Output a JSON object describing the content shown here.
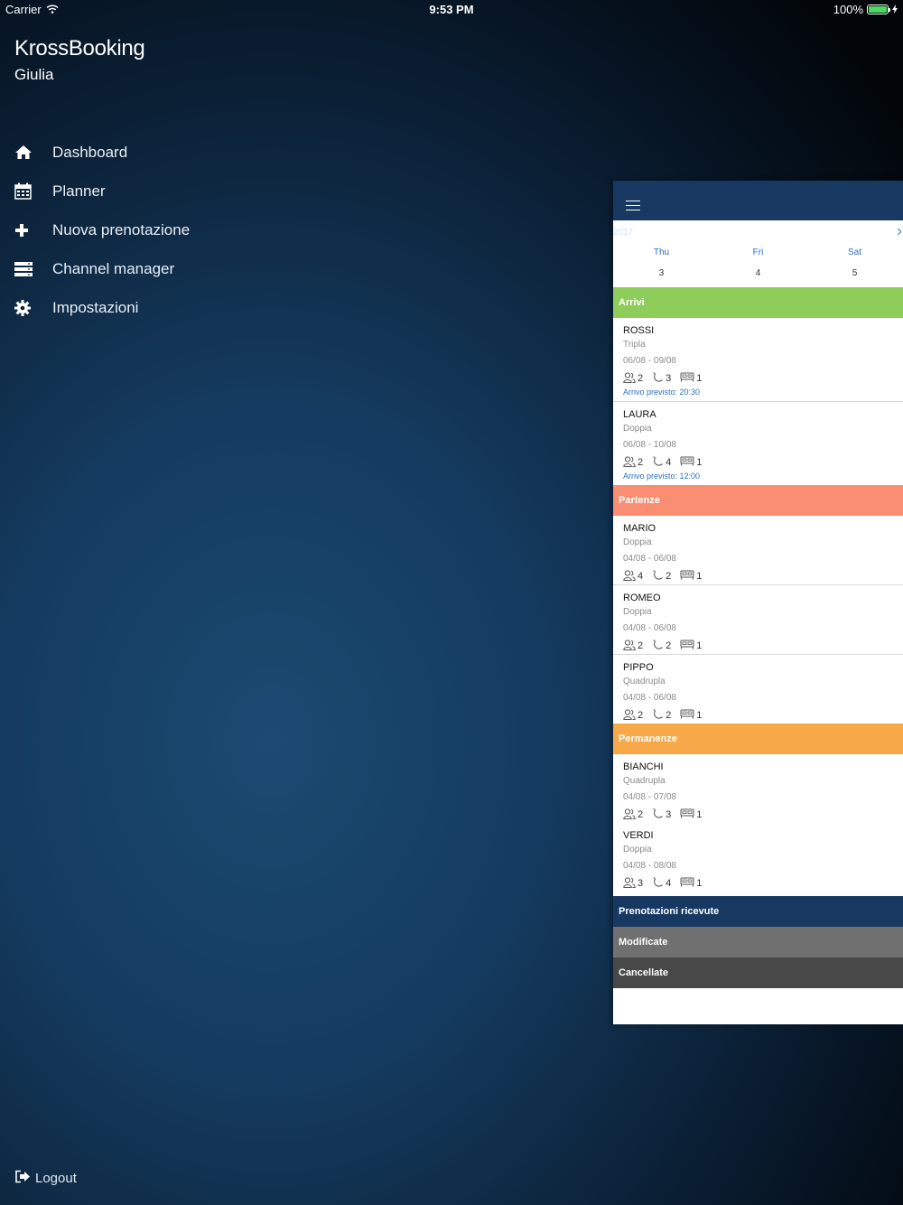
{
  "status_bar": {
    "carrier": "Carrier",
    "time": "9:53 PM",
    "battery": "100%"
  },
  "drawer": {
    "app_title": "KrossBooking",
    "user": "Giulia",
    "menu": [
      {
        "label": "Dashboard",
        "icon": "home-icon"
      },
      {
        "label": "Planner",
        "icon": "calendar-icon"
      },
      {
        "label": "Nuova prenotazione",
        "icon": "plus-icon"
      },
      {
        "label": "Channel manager",
        "icon": "server-icon"
      },
      {
        "label": "Impostazioni",
        "icon": "gear-icon"
      }
    ],
    "logout": "Logout"
  },
  "panel": {
    "year": "2017",
    "days": [
      {
        "name": "Thu",
        "num": "3"
      },
      {
        "name": "Fri",
        "num": "4"
      },
      {
        "name": "Sat",
        "num": "5"
      }
    ],
    "sections": {
      "arrivi": "Arrivi",
      "partenze": "Partenze",
      "permanenze": "Permanenze",
      "ricevute": "Prenotazioni ricevute",
      "modificate": "Modificate",
      "cancellate": "Cancellate"
    },
    "arrivi": [
      {
        "name": "ROSSI",
        "room": "Tripla",
        "dates": "06/08 - 09/08",
        "guests": "2",
        "nights": "3",
        "rooms": "1",
        "eta": "Arrivo previsto: 20:30"
      },
      {
        "name": "LAURA",
        "room": "Doppia",
        "dates": "06/08 - 10/08",
        "guests": "2",
        "nights": "4",
        "rooms": "1",
        "eta": "Arrivo previsto: 12:00"
      }
    ],
    "partenze": [
      {
        "name": "MARIO",
        "room": "Doppia",
        "dates": "04/08 - 06/08",
        "guests": "4",
        "nights": "2",
        "rooms": "1"
      },
      {
        "name": "ROMEO",
        "room": "Doppia",
        "dates": "04/08 - 06/08",
        "guests": "2",
        "nights": "2",
        "rooms": "1"
      },
      {
        "name": "PIPPO",
        "room": "Quadrupla",
        "dates": "04/08 - 06/08",
        "guests": "2",
        "nights": "2",
        "rooms": "1"
      }
    ],
    "permanenze": [
      {
        "name": "BIANCHI",
        "room": "Quadrupla",
        "dates": "04/08 - 07/08",
        "guests": "2",
        "nights": "3",
        "rooms": "1"
      },
      {
        "name": "VERDI",
        "room": "Doppia",
        "dates": "04/08 - 08/08",
        "guests": "3",
        "nights": "4",
        "rooms": "1"
      }
    ]
  },
  "colors": {
    "arrivi": "#8fcd5b",
    "partenze": "#f98e73",
    "permanenze": "#f7a94a",
    "ricevute": "#163861",
    "modificate": "#707070",
    "cancellate": "#484848",
    "accent": "#2b6fbf"
  }
}
